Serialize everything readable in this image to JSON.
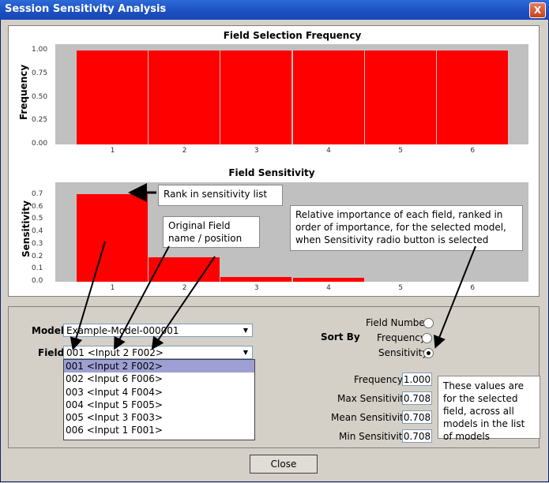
{
  "window": {
    "title": "Session Sensitivity Analysis",
    "close_symbol": "X"
  },
  "chart_data": [
    {
      "type": "bar",
      "title": "Field Selection Frequency",
      "ylabel": "Frequency",
      "xlabel": "",
      "categories": [
        "1",
        "2",
        "3",
        "4",
        "5",
        "6"
      ],
      "values": [
        1.0,
        1.0,
        1.0,
        1.0,
        1.0,
        1.0
      ],
      "yticks": [
        "0.00",
        "0.25",
        "0.50",
        "0.75",
        "1.00"
      ],
      "ylim": [
        0,
        1.0
      ],
      "bar_color": "#ff0000",
      "plot_bg": "#c0c0c0"
    },
    {
      "type": "bar",
      "title": "Field Sensitivity",
      "ylabel": "Sensitivity",
      "xlabel": "",
      "categories": [
        "1",
        "2",
        "3",
        "4",
        "5",
        "6"
      ],
      "values": [
        0.708,
        0.2,
        0.04,
        0.03,
        0,
        0
      ],
      "yticks": [
        "0.0",
        "0.1",
        "0.2",
        "0.3",
        "0.4",
        "0.5",
        "0.6",
        "0.7"
      ],
      "ylim": [
        0,
        0.75
      ],
      "bar_color": "#ff0000",
      "plot_bg": "#c0c0c0"
    }
  ],
  "callouts": {
    "rank": "Rank in sensitivity list",
    "original_field": "Original Field name / position",
    "relative": "Relative importance of each field, ranked in order of importance, for the selected model, when Sensitivity radio button is selected",
    "values_note": "These values are for the selected field, across all models in the list of models"
  },
  "controls": {
    "model_label": "Model",
    "model_value": "Example-Model-000001",
    "field_label": "Field",
    "field_value": "001 <Input 2 F002>",
    "field_options": [
      "001 <Input 2 F002>",
      "002 <Input 6 F006>",
      "003 <Input 4 F004>",
      "004 <Input 5 F005>",
      "005 <Input 3 F003>",
      "006 <Input 1 F001>"
    ],
    "sort_by_label": "Sort By",
    "sort_options": [
      "Field Number",
      "Frequency",
      "Sensitivity"
    ],
    "sort_selected": "Sensitivity",
    "stats": [
      {
        "label": "Frequency",
        "value": "1.000"
      },
      {
        "label": "Max Sensitivity",
        "value": "0.708"
      },
      {
        "label": "Mean Sensitivity",
        "value": "0.708"
      },
      {
        "label": "Min Sensitivity",
        "value": "0.708"
      }
    ],
    "close_button": "Close"
  }
}
